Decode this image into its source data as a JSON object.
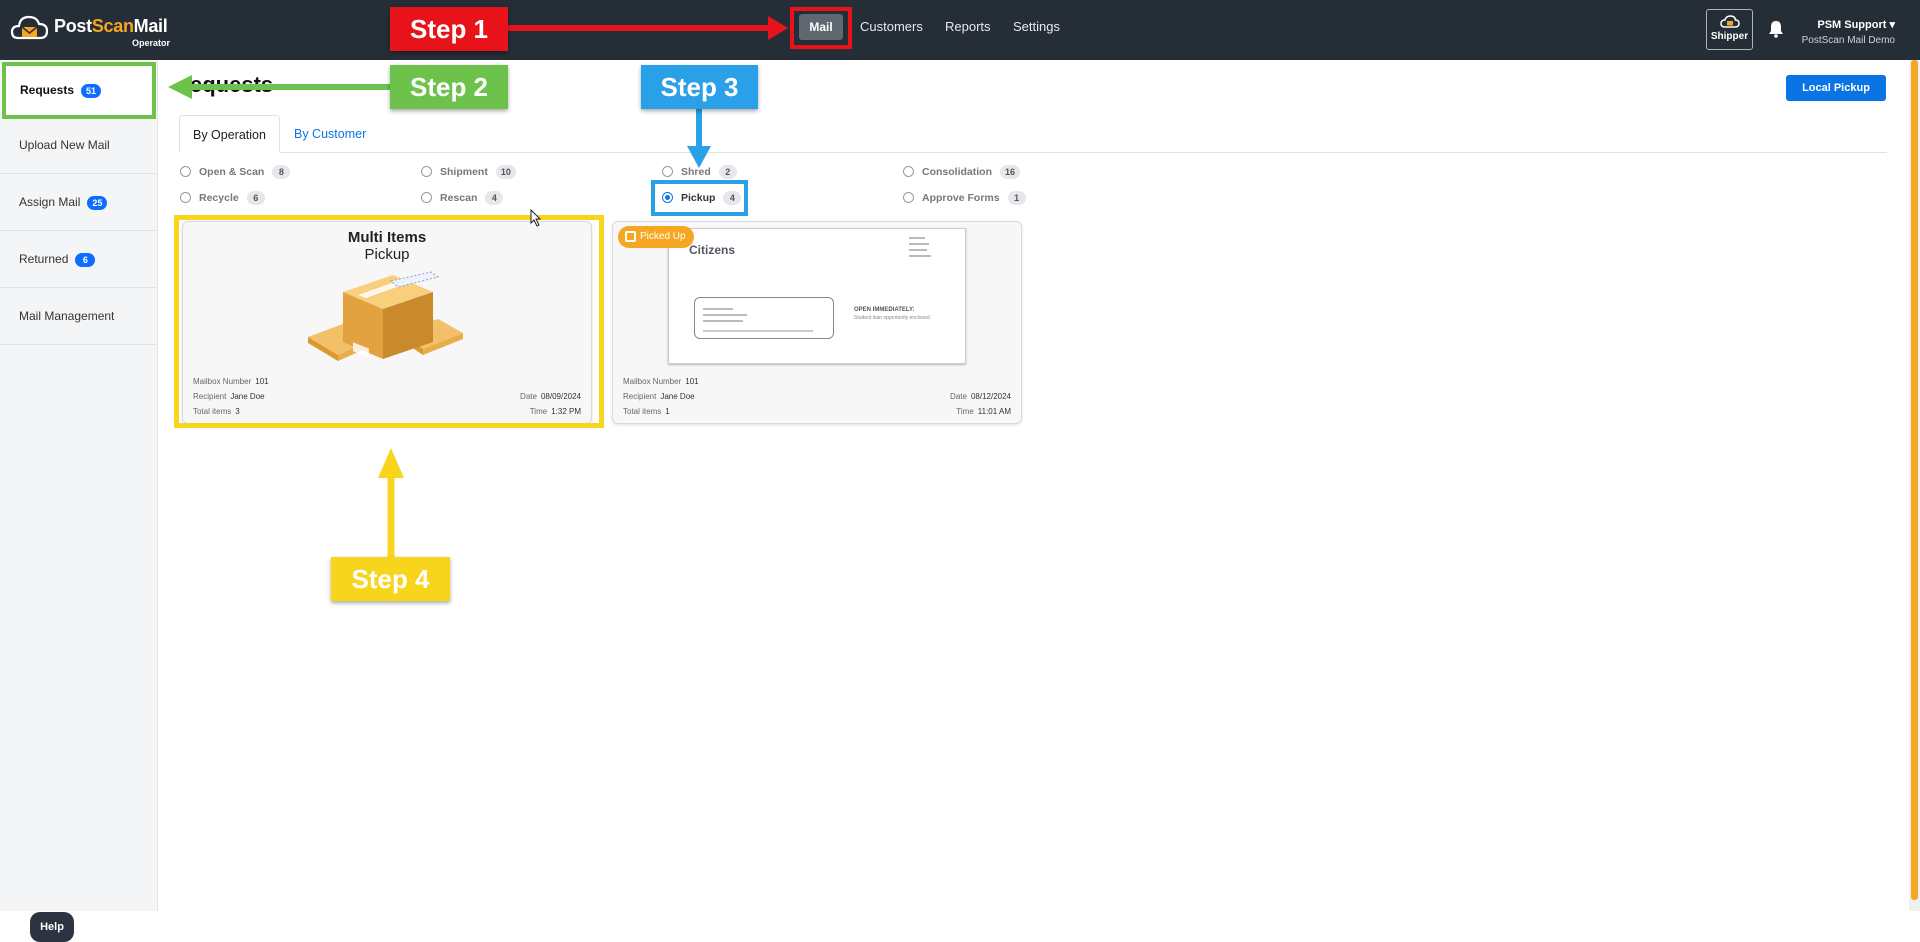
{
  "brand": {
    "name_part1": "Post",
    "name_part2": "Scan",
    "name_part3": "Mail",
    "subtitle": "Operator",
    "accent": "#f5a623"
  },
  "topnav": {
    "items": [
      "Mail",
      "Customers",
      "Reports",
      "Settings"
    ],
    "active": "Mail"
  },
  "header": {
    "shipper_label": "Shipper",
    "user_name": "PSM Support",
    "user_org": "PostScan Mail Demo"
  },
  "sidebar": {
    "items": [
      {
        "label": "Requests",
        "badge": "51"
      },
      {
        "label": "Upload New Mail",
        "badge": ""
      },
      {
        "label": "Assign Mail",
        "badge": "25"
      },
      {
        "label": "Returned",
        "badge": "6"
      },
      {
        "label": "Mail Management",
        "badge": ""
      }
    ],
    "help_label": "Help"
  },
  "main": {
    "title": "equests",
    "local_pickup_label": "Local Pickup",
    "tabs": [
      "By Operation",
      "By Customer"
    ],
    "filters": [
      {
        "label": "Open & Scan",
        "count": "8"
      },
      {
        "label": "Shipment",
        "count": "10"
      },
      {
        "label": "Shred",
        "count": "2"
      },
      {
        "label": "Consolidation",
        "count": "16"
      },
      {
        "label": "Recycle",
        "count": "6"
      },
      {
        "label": "Rescan",
        "count": "4"
      },
      {
        "label": "Pickup",
        "count": "4",
        "selected": true
      },
      {
        "label": "Approve Forms",
        "count": "1"
      }
    ],
    "cards": [
      {
        "title_line1": "Multi Items",
        "title_line2": "Pickup",
        "mailbox_label": "Mailbox Number",
        "mailbox": "101",
        "recipient_label": "Recipient",
        "recipient": "Jane Doe",
        "total_label": "Total items",
        "total": "3",
        "date_label": "Date",
        "date": "08/09/2024",
        "time_label": "Time",
        "time": "1:32 PM"
      },
      {
        "status_badge": "Picked Up",
        "letter_logo": "Citizens",
        "letter_heading": "OPEN IMMEDIATELY:",
        "letter_sub": "Student loan opportunity enclosed.",
        "mailbox_label": "Mailbox Number",
        "mailbox": "101",
        "recipient_label": "Recipient",
        "recipient": "Jane Doe",
        "total_label": "Total items",
        "total": "1",
        "date_label": "Date",
        "date": "08/12/2024",
        "time_label": "Time",
        "time": "11:01 AM"
      }
    ]
  },
  "annotations": {
    "step1": "Step 1",
    "step2": "Step 2",
    "step3": "Step 3",
    "step4": "Step 4",
    "colors": {
      "step1": "#e8131a",
      "step2": "#6cc24a",
      "step3": "#29a0e8",
      "step4": "#f7d51d"
    }
  }
}
